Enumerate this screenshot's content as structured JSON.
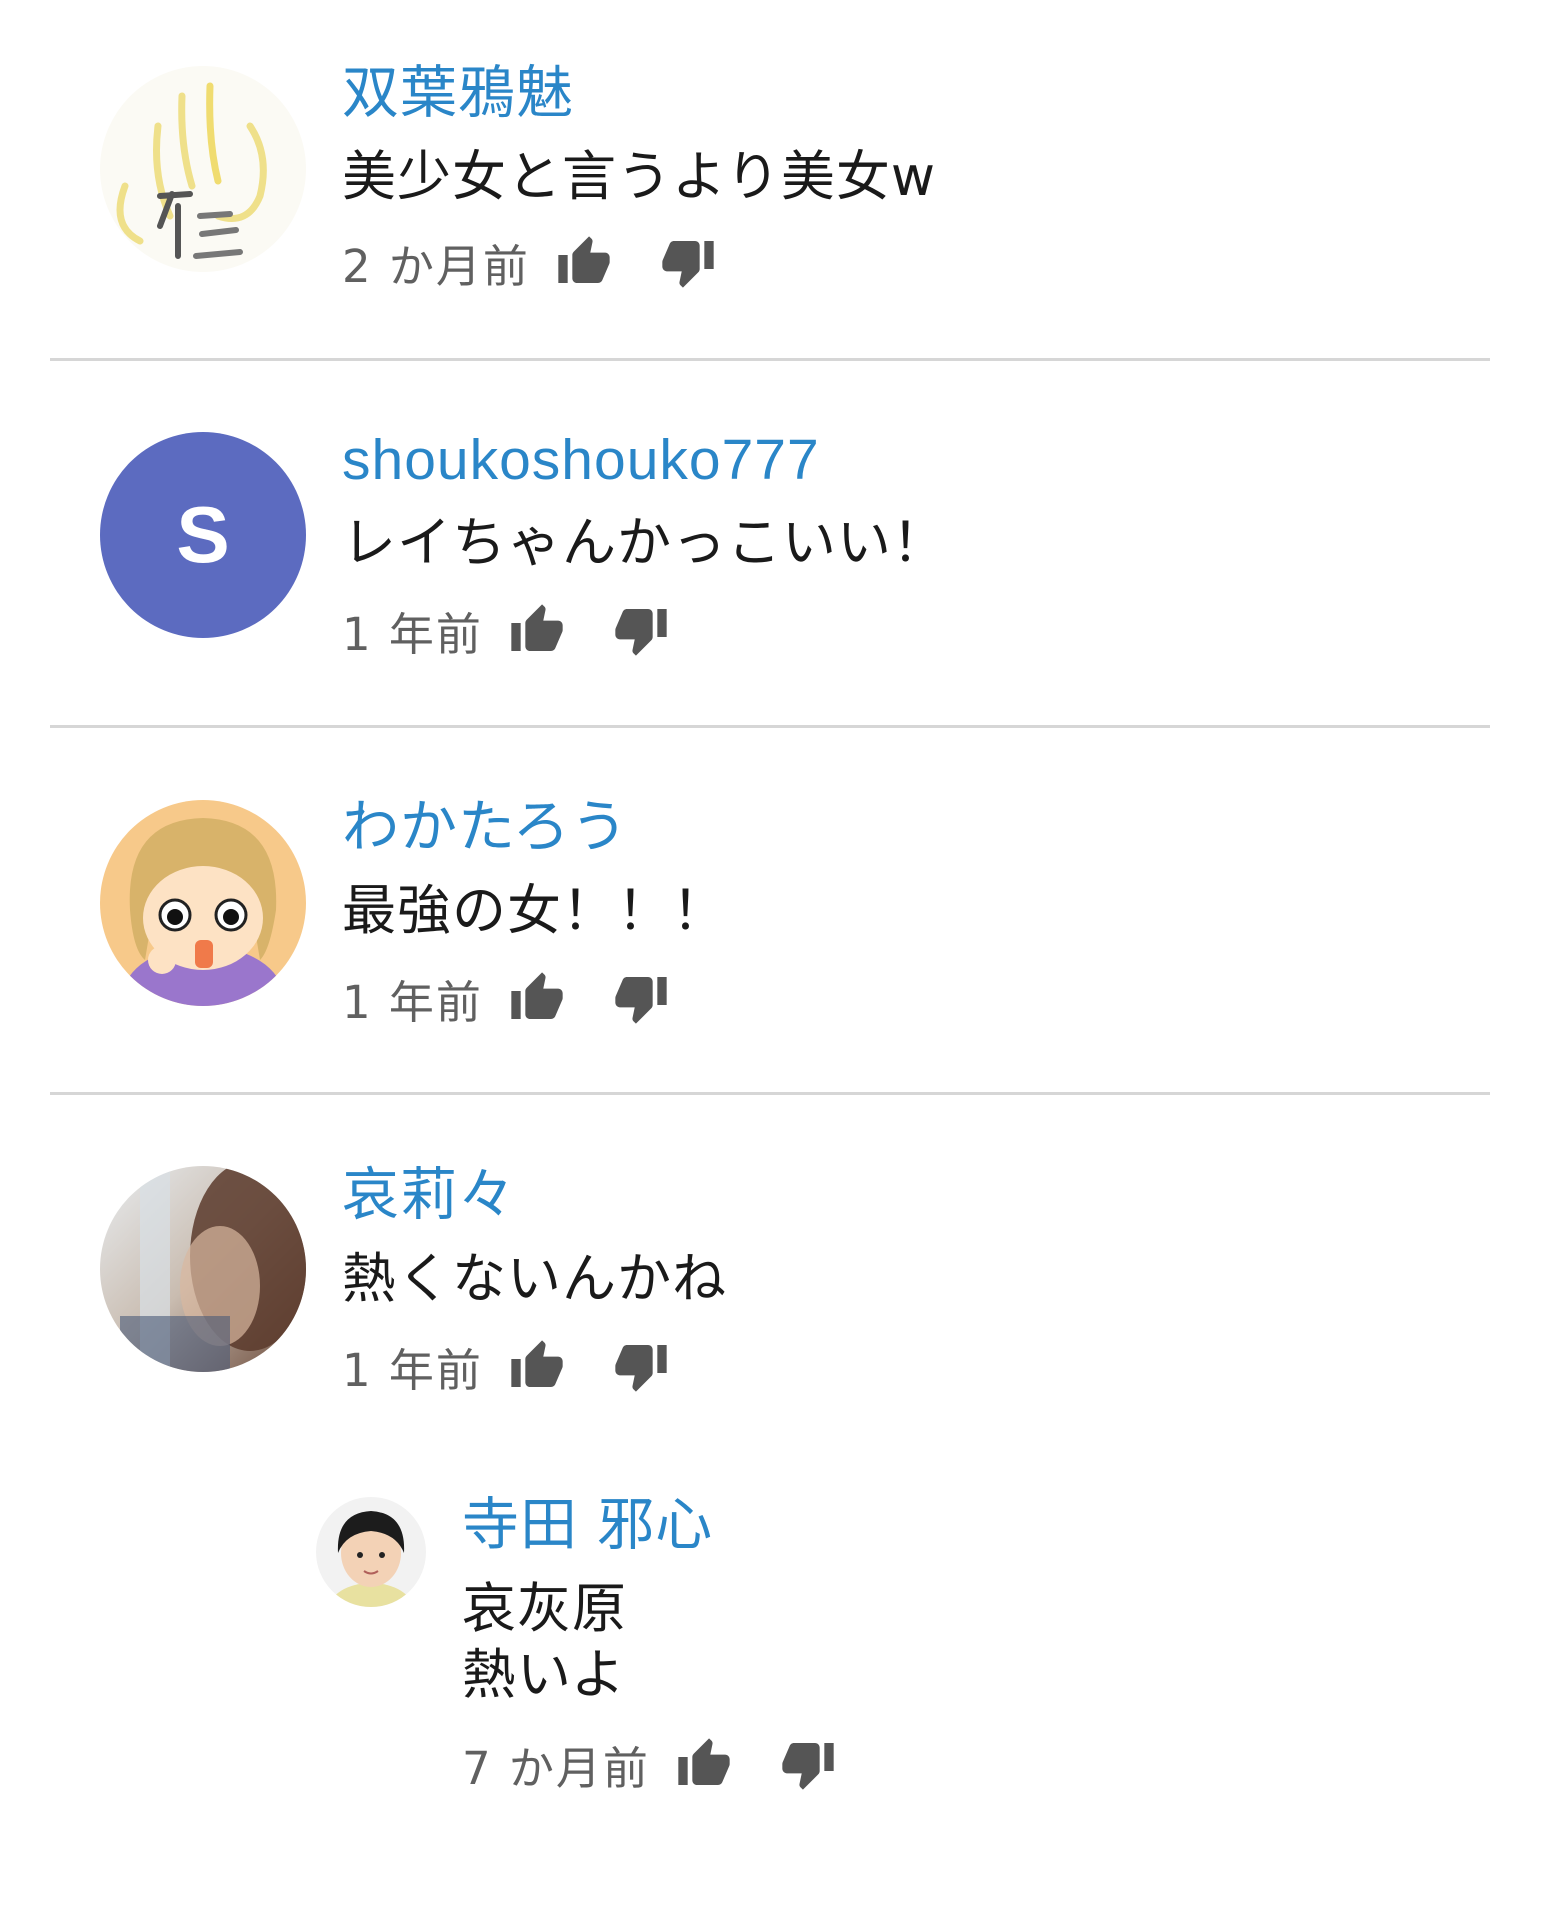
{
  "colors": {
    "author": "#2a86c8",
    "text": "#1a1a1a",
    "meta": "#606060",
    "icon": "#555555",
    "divider": "#d6d6d6",
    "avatar_s_bg": "#5c6bc0"
  },
  "comments": [
    {
      "author": "双葉鴉魅",
      "text": "美少女と言うより美女w",
      "time": "2 か月前",
      "avatar": "sketch-avatar"
    },
    {
      "author": "shoukoshouko777",
      "text": "レイちゃんかっこいい！",
      "time": "1 年前",
      "avatar": "letter-avatar",
      "avatar_letter": "S"
    },
    {
      "author": "わかたろう",
      "text": "最強の女！！！",
      "time": "1 年前",
      "avatar": "cartoon-avatar"
    },
    {
      "author": "哀莉々",
      "text": "熱くないんかね",
      "time": "1 年前",
      "avatar": "photo-avatar",
      "reply": {
        "author": "寺田 邪心",
        "text_line1": "哀灰原",
        "text_line2": "熱いよ",
        "time": "7 か月前",
        "avatar": "child-photo-avatar"
      }
    }
  ],
  "icons": {
    "like": "thumbs-up-icon",
    "dislike": "thumbs-down-icon"
  }
}
